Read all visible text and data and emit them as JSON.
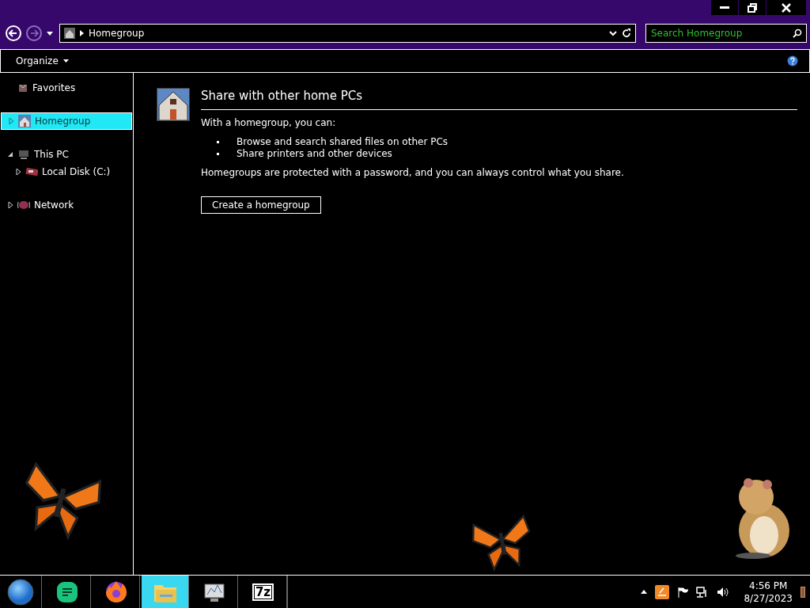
{
  "address_bar": {
    "location": "Homegroup",
    "search_placeholder": "Search Homegroup"
  },
  "toolbar": {
    "organize": "Organize"
  },
  "sidebar": {
    "items": [
      {
        "label": "Favorites",
        "kind": "favorites",
        "selected": false
      },
      {
        "label": "Homegroup",
        "kind": "homegroup",
        "selected": true,
        "expanded": false
      },
      {
        "label": "This PC",
        "kind": "computer",
        "selected": false,
        "expanded": true,
        "children": [
          {
            "label": "Local Disk (C:)",
            "kind": "disk",
            "selected": false,
            "expanded": false
          }
        ]
      },
      {
        "label": "Network",
        "kind": "network",
        "selected": false,
        "expanded": false
      }
    ]
  },
  "content": {
    "title": "Share with other home PCs",
    "intro": "With a homegroup, you can:",
    "bullets": [
      "Browse and search shared files on other PCs",
      "Share printers and other devices"
    ],
    "note": "Homegroups are protected with a password, and you can always control what you share.",
    "button": "Create a homegroup"
  },
  "taskbar": {
    "items": [
      {
        "kind": "orb",
        "selected": false
      },
      {
        "kind": "notes",
        "selected": false
      },
      {
        "kind": "browser",
        "selected": false
      },
      {
        "kind": "folder",
        "selected": true
      },
      {
        "kind": "monitor",
        "selected": false
      },
      {
        "kind": "archiver",
        "label": "7z",
        "selected": false
      }
    ],
    "time": "4:56 PM",
    "date": "8/27/2023"
  }
}
